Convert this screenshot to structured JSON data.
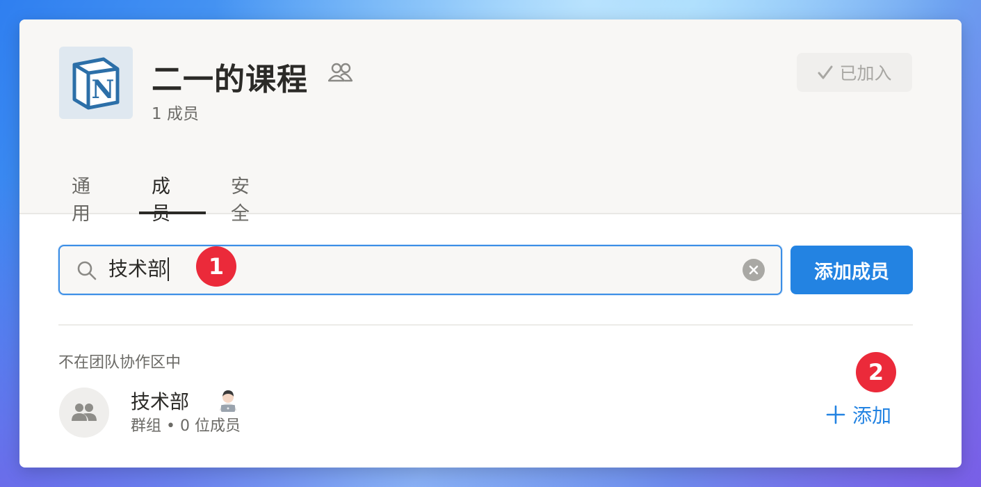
{
  "workspace": {
    "title": "二一的课程",
    "member_count": "1 成员",
    "logo_letter": "N",
    "joined_label": "已加入"
  },
  "tabs": [
    {
      "label": "通用",
      "active": false
    },
    {
      "label": "成员",
      "active": true
    },
    {
      "label": "安全",
      "active": false
    }
  ],
  "search": {
    "value": "技术部",
    "marker": "1"
  },
  "add_member_label": "添加成员",
  "section_label": "不在团队协作区中",
  "result": {
    "name": "技术部",
    "meta": "群组 • 0 位成员",
    "add_label": "添加",
    "marker": "2"
  },
  "colors": {
    "accent": "#2383e2",
    "marker": "#eb2a3a",
    "focus_border": "#3b8ee6"
  },
  "icons": {
    "logo": "notion-logo-icon",
    "group": "group-icon",
    "check": "check-icon",
    "search": "search-icon",
    "clear": "clear-icon",
    "avatar": "group-avatar-icon",
    "emoji": "technologist-emoji",
    "plus": "plus-icon"
  }
}
